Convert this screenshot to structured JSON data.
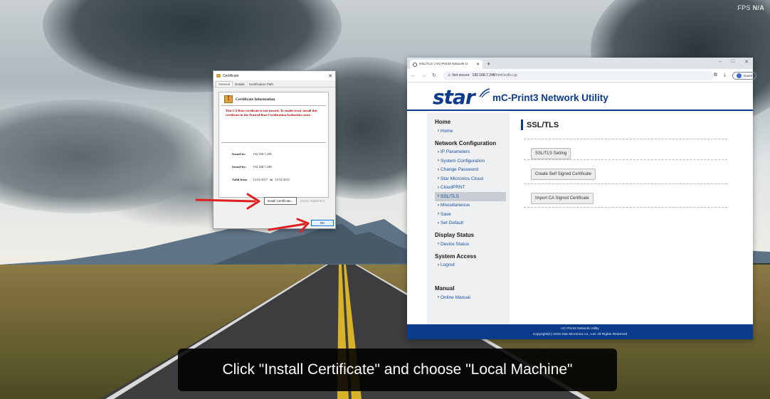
{
  "overlay": {
    "fps_label": "FPS",
    "fps_value": "N/A"
  },
  "caption": "Click \"Install Certificate\" and choose \"Local Machine\"",
  "certificate_dialog": {
    "title": "Certificate",
    "tabs": [
      "General",
      "Details",
      "Certification Path"
    ],
    "header": "Certificate Information",
    "warning": "This CA Root certificate is not trusted. To enable trust, install this certificate in the Trusted Root Certification Authorities store.",
    "issued_to_label": "Issued to:",
    "issued_to": "192.168.7.248",
    "issued_by_label": "Issued by:",
    "issued_by": "192.168.7.248",
    "valid_from_label": "Valid from",
    "valid_from": "12/31/2017",
    "valid_to_label": "to",
    "valid_to": "12/31/2031",
    "install_button": "Install Certificate...",
    "issuer_statement": "Issuer Statement",
    "ok_button": "OK"
  },
  "browser": {
    "tab_title": "SSL/TLS | mC-Print3 Network U",
    "security_label": "Not secure",
    "url_host": "192.168.7.248",
    "url_path": "/html/ssltls.cgi",
    "profile_label": "Guest",
    "window_controls": [
      "–",
      "□",
      "✕"
    ],
    "nav_icons": [
      "back-arrow",
      "forward-arrow",
      "reload"
    ],
    "toolbar_icons": [
      "install-app",
      "download",
      "more-vert"
    ]
  },
  "page": {
    "logo_text": "star",
    "app_title": "mC-Print3 Network Utility",
    "sidebar": {
      "home": {
        "heading": "Home",
        "items": [
          "Home"
        ]
      },
      "network": {
        "heading": "Network Configuration",
        "items": [
          "IP Parameters",
          "System Configuration",
          "Change Password",
          "Star Micronics Cloud",
          "CloudPRNT",
          "SSL/TLS",
          "Miscellaneous",
          "Save",
          "Set Default"
        ],
        "active_index": 5
      },
      "display": {
        "heading": "Display Status",
        "items": [
          "Device Status"
        ]
      },
      "access": {
        "heading": "System Access",
        "items": [
          "Logout"
        ]
      },
      "manual": {
        "heading": "Manual",
        "items": [
          "Online Manual"
        ]
      }
    },
    "content": {
      "title": "SSL/TLS",
      "buttons": [
        "SSL/TLS Setting",
        "Create Self Signed Certificate",
        "Import CA Signed Certificate"
      ]
    },
    "footer_line1": "mC-Print3 Network Utility",
    "footer_line2": "Copyright(C) 2018 Star Micronics co., Ltd. All Rights Reserved"
  },
  "colors": {
    "brand": "#0d3b8c",
    "arrow": "#e02020",
    "warning_text": "#b00000"
  }
}
